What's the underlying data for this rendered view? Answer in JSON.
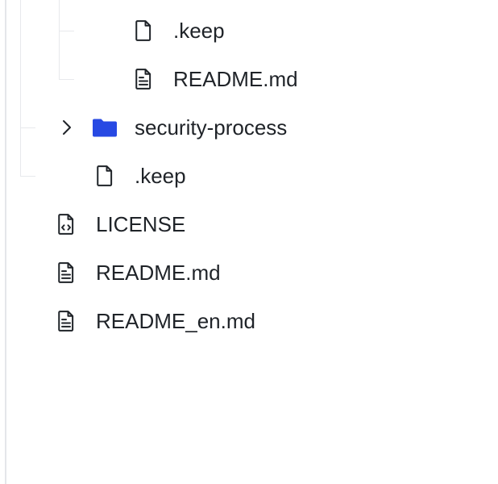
{
  "tree": {
    "items": [
      {
        "label": ".keep",
        "icon": "file-icon"
      },
      {
        "label": "README.md",
        "icon": "file-text-icon"
      },
      {
        "label": "security-process",
        "icon": "folder-icon",
        "collapsed": true
      },
      {
        "label": ".keep",
        "icon": "file-icon"
      },
      {
        "label": "LICENSE",
        "icon": "file-code-icon"
      },
      {
        "label": "README.md",
        "icon": "file-text-icon"
      },
      {
        "label": "README_en.md",
        "icon": "file-text-icon"
      }
    ]
  },
  "colors": {
    "folder": "#2749e3",
    "icon_stroke": "#1f2328",
    "guide": "#e7e9ec"
  }
}
